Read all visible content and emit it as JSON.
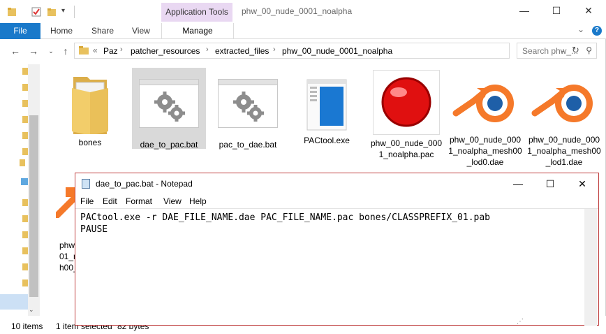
{
  "explorer": {
    "title": "phw_00_nude_0001_noalpha",
    "context_tab": "Application Tools",
    "ribbon": {
      "file": "File",
      "home": "Home",
      "share": "Share",
      "view": "View",
      "manage": "Manage",
      "help": "?"
    },
    "window_controls": {
      "minimize": "—",
      "maximize": "☐",
      "close": "✕"
    },
    "address": {
      "overflow": "«",
      "crumbs": [
        "Paz",
        "patcher_resources",
        "extracted_files",
        "phw_00_nude_0001_noalpha"
      ],
      "separator": "›"
    },
    "search_placeholder": "Search phw_...",
    "files": [
      {
        "name": "bones",
        "type": "folder"
      },
      {
        "name": "dae_to_pac.bat",
        "type": "bat",
        "selected": true
      },
      {
        "name": "pac_to_dae.bat",
        "type": "bat"
      },
      {
        "name": "PACtool.exe",
        "type": "exe"
      },
      {
        "name": "phw_00_nude_0001_noalpha.pac",
        "type": "pac"
      },
      {
        "name": "phw_00_nude_0001_noalpha_mesh00_lod0.dae",
        "type": "dae"
      },
      {
        "name": "phw_00_nude_0001_noalpha_mesh00_lod1.dae",
        "type": "dae"
      }
    ],
    "partial_file_label_lines": [
      "phw",
      "01_n",
      "h00_"
    ],
    "status": {
      "items": "10 items",
      "selected": "1 item selected",
      "size": "82 bytes"
    }
  },
  "notepad": {
    "title": "dae_to_pac.bat - Notepad",
    "menu": [
      "File",
      "Edit",
      "Format",
      "View",
      "Help"
    ],
    "controls": {
      "minimize": "—",
      "maximize": "☐",
      "close": "✕"
    },
    "lines": [
      "PACtool.exe -r DAE_FILE_NAME.dae PAC_FILE_NAME.pac bones/CLASSPREFIX_01.pab",
      "PAUSE"
    ]
  },
  "colors": {
    "accent": "#1979ca",
    "context_tab": "#e9d8f2",
    "notepad_border": "#c04040",
    "selection": "#d9d9d9",
    "blender_orange": "#f5792a",
    "blender_blue": "#1e5fa8",
    "ball_red": "#e01010"
  }
}
